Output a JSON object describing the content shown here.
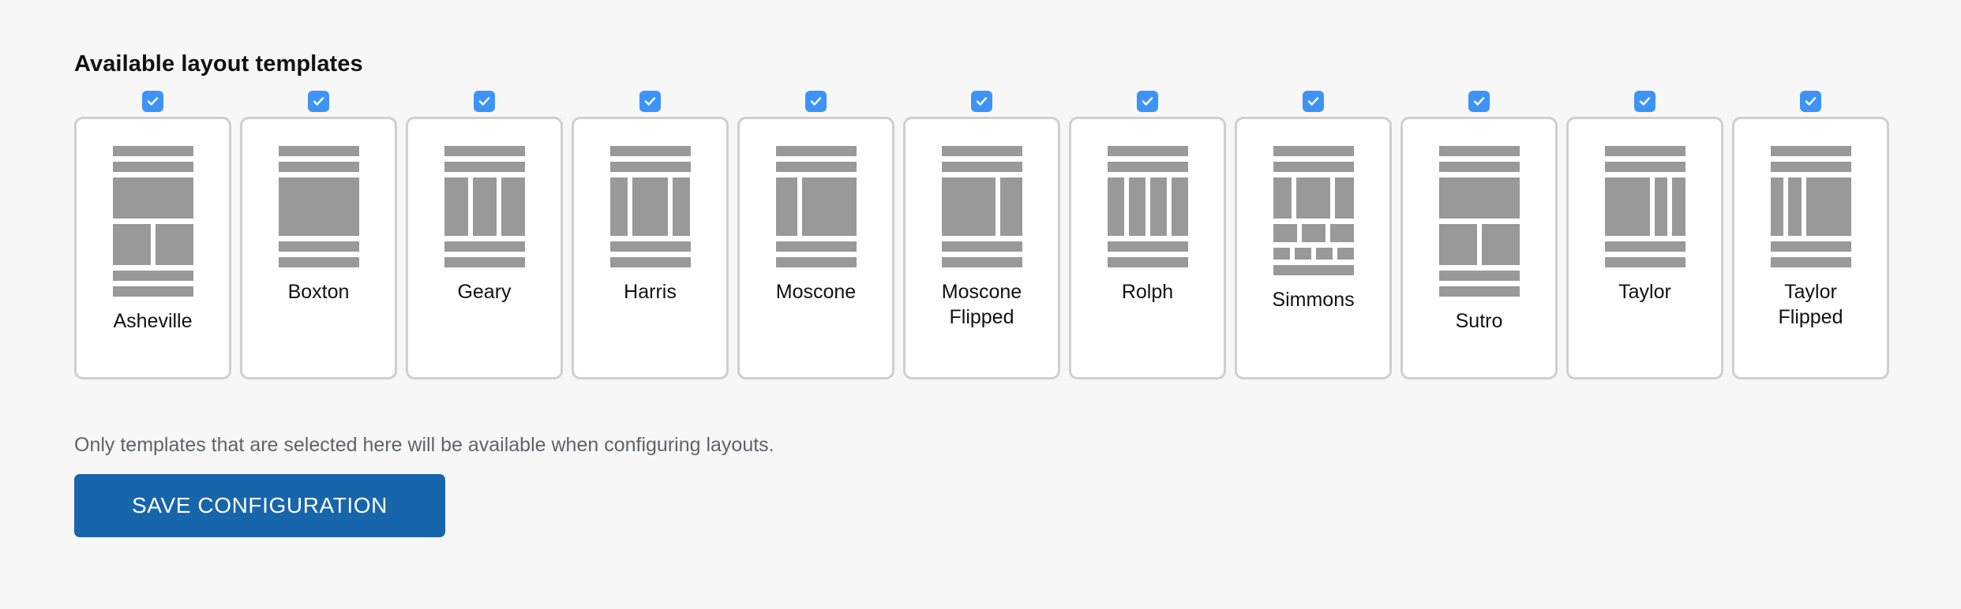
{
  "heading": "Available layout templates",
  "help_text": "Only templates that are selected here will be available when configuring layouts.",
  "save_button_label": "SAVE CONFIGURATION",
  "colors": {
    "page_background": "#f7f7f7",
    "card_background": "#ffffff",
    "card_border": "#cfcfcf",
    "checkbox_accent": "#3d94f6",
    "thumbnail_block": "#999999",
    "button_background": "#1765ab",
    "button_text": "#ffffff",
    "help_text": "#5e6468",
    "heading_text": "#111111"
  },
  "checkbox_icon": "checkmark-icon",
  "templates": [
    {
      "name": "Asheville",
      "checked": true,
      "rows": [
        {
          "type": "bar",
          "size": "thin"
        },
        {
          "type": "bar",
          "size": "thin"
        },
        {
          "type": "bar",
          "size": "block"
        },
        {
          "type": "cols",
          "height": "h-mid",
          "widths": [
            1,
            1
          ]
        },
        {
          "type": "bar",
          "size": "thin"
        },
        {
          "type": "bar",
          "size": "thin"
        }
      ]
    },
    {
      "name": "Boxton",
      "checked": true,
      "rows": [
        {
          "type": "bar",
          "size": "thin"
        },
        {
          "type": "bar",
          "size": "thin"
        },
        {
          "type": "bar",
          "size": "tall"
        },
        {
          "type": "bar",
          "size": "thin"
        },
        {
          "type": "bar",
          "size": "thin"
        }
      ]
    },
    {
      "name": "Geary",
      "checked": true,
      "rows": [
        {
          "type": "bar",
          "size": "thin"
        },
        {
          "type": "bar",
          "size": "thin"
        },
        {
          "type": "cols",
          "height": "h-tall",
          "widths": [
            1,
            1,
            1
          ]
        },
        {
          "type": "bar",
          "size": "thin"
        },
        {
          "type": "bar",
          "size": "thin"
        }
      ]
    },
    {
      "name": "Harris",
      "checked": true,
      "rows": [
        {
          "type": "bar",
          "size": "thin"
        },
        {
          "type": "bar",
          "size": "thin"
        },
        {
          "type": "cols",
          "height": "h-tall",
          "widths": [
            0.72,
            1.48,
            0.72
          ]
        },
        {
          "type": "bar",
          "size": "thin"
        },
        {
          "type": "bar",
          "size": "thin"
        }
      ]
    },
    {
      "name": "Moscone",
      "checked": true,
      "rows": [
        {
          "type": "bar",
          "size": "thin"
        },
        {
          "type": "bar",
          "size": "thin"
        },
        {
          "type": "cols",
          "height": "h-tall",
          "widths": [
            0.85,
            2.15
          ]
        },
        {
          "type": "bar",
          "size": "thin"
        },
        {
          "type": "bar",
          "size": "thin"
        }
      ]
    },
    {
      "name": "Moscone\nFlipped",
      "checked": true,
      "rows": [
        {
          "type": "bar",
          "size": "thin"
        },
        {
          "type": "bar",
          "size": "thin"
        },
        {
          "type": "cols",
          "height": "h-tall",
          "widths": [
            2.15,
            0.85
          ]
        },
        {
          "type": "bar",
          "size": "thin"
        },
        {
          "type": "bar",
          "size": "thin"
        }
      ]
    },
    {
      "name": "Rolph",
      "checked": true,
      "rows": [
        {
          "type": "bar",
          "size": "thin"
        },
        {
          "type": "bar",
          "size": "thin"
        },
        {
          "type": "cols",
          "height": "h-tall",
          "widths": [
            1,
            1,
            1,
            1
          ]
        },
        {
          "type": "bar",
          "size": "thin"
        },
        {
          "type": "bar",
          "size": "thin"
        }
      ]
    },
    {
      "name": "Simmons",
      "checked": true,
      "rows": [
        {
          "type": "bar",
          "size": "thin"
        },
        {
          "type": "bar",
          "size": "thin"
        },
        {
          "type": "cols",
          "height": "h-mid",
          "widths": [
            0.78,
            1.44,
            0.78
          ]
        },
        {
          "type": "cols",
          "height": "h-row",
          "widths": [
            1,
            1,
            1
          ]
        },
        {
          "type": "cols",
          "height": "h-small",
          "widths": [
            1,
            1,
            1,
            1
          ]
        },
        {
          "type": "bar",
          "size": "thin"
        }
      ]
    },
    {
      "name": "Sutro",
      "checked": true,
      "rows": [
        {
          "type": "bar",
          "size": "thin"
        },
        {
          "type": "bar",
          "size": "thin"
        },
        {
          "type": "bar",
          "size": "block"
        },
        {
          "type": "cols",
          "height": "h-mid",
          "widths": [
            1,
            1
          ]
        },
        {
          "type": "bar",
          "size": "thin"
        },
        {
          "type": "bar",
          "size": "thin"
        }
      ]
    },
    {
      "name": "Taylor",
      "checked": true,
      "rows": [
        {
          "type": "bar",
          "size": "thin"
        },
        {
          "type": "bar",
          "size": "thin"
        },
        {
          "type": "cols",
          "height": "h-tall",
          "widths": [
            1.9,
            0.55,
            0.55
          ]
        },
        {
          "type": "bar",
          "size": "thin"
        },
        {
          "type": "bar",
          "size": "thin"
        }
      ]
    },
    {
      "name": "Taylor\nFlipped",
      "checked": true,
      "rows": [
        {
          "type": "bar",
          "size": "thin"
        },
        {
          "type": "bar",
          "size": "thin"
        },
        {
          "type": "cols",
          "height": "h-tall",
          "widths": [
            0.55,
            0.55,
            1.9
          ]
        },
        {
          "type": "bar",
          "size": "thin"
        },
        {
          "type": "bar",
          "size": "thin"
        }
      ]
    }
  ]
}
